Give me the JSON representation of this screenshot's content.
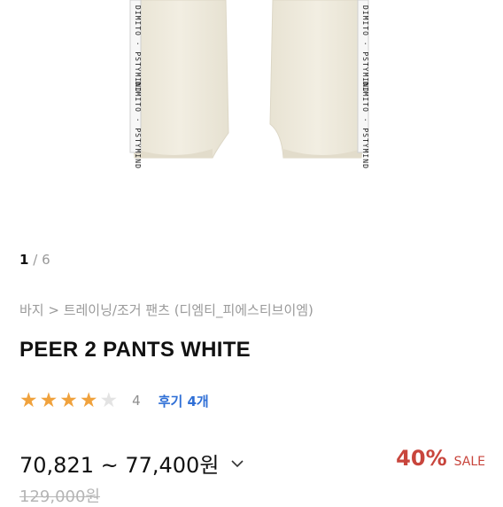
{
  "gallery": {
    "current": "1",
    "separator": "/",
    "total": "6",
    "tape_text": "DIMITO · PSTYMIND"
  },
  "breadcrumb": "바지 > 트레이닝/조거 팬츠 (디엠티_피에스티브이엠)",
  "product": {
    "title": "PEER 2 PANTS WHITE"
  },
  "rating": {
    "value": "4",
    "stars_filled": 4,
    "stars_total": 5,
    "reviews_label": "후기 4개"
  },
  "price": {
    "range": "70,821 ~ 77,400원",
    "discount": "40%",
    "sale_label": "SALE",
    "original": "129,000원"
  },
  "colors": {
    "star": "#f0a23d",
    "discount": "#c8453c",
    "link": "#2f6fd6",
    "pants": "#efeadc"
  }
}
